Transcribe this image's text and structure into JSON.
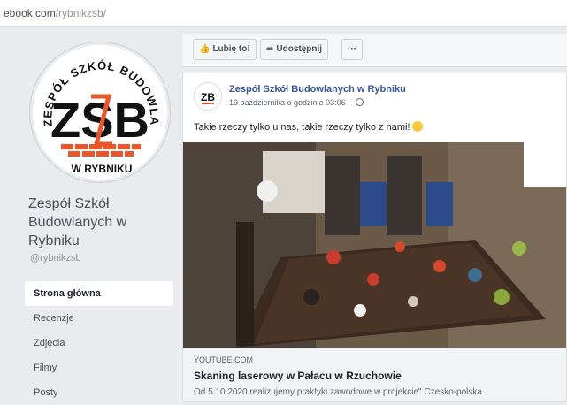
{
  "browser": {
    "url_domain": "ebook.com",
    "url_path": "/rybnikzsb/"
  },
  "page": {
    "logo_text_arc": "ZESPÓŁ SZKÓŁ BUDOWLANYCH",
    "logo_letters": "ZSB",
    "logo_bottom": "W RYBNIKU",
    "name_line1": "Zespół Szkół",
    "name_line2": "Budowlanych w",
    "name_line3": "Rybniku",
    "handle": "@rybnikzsb",
    "brand_color": "#e8562a"
  },
  "nav": {
    "items": [
      {
        "label": "Strona główna",
        "active": true
      },
      {
        "label": "Recenzje",
        "active": false
      },
      {
        "label": "Zdjęcia",
        "active": false
      },
      {
        "label": "Filmy",
        "active": false
      },
      {
        "label": "Posty",
        "active": false
      }
    ]
  },
  "actions": {
    "like_label": "Lubię to!",
    "share_label": "Udostępnij",
    "more_label": "···"
  },
  "post": {
    "avatar_text": "ZB",
    "author": "Zespół Szkół Budowlanych w Rybniku",
    "meta": "19 października o godzinie 03:06 · ",
    "text": "Takie rzeczy tylko u nas, takie rzeczy tylko z nami!",
    "link": {
      "domain": "YOUTUBE.COM",
      "title": "Skaning laserowy w Pałacu w Rzuchowie",
      "description": "Od 5.10.2020 realizujemy praktyki zawodowe w projekcie\" Czesko-polska"
    }
  },
  "colors": {
    "link_blue": "#385898",
    "background": "#e9ebee"
  }
}
